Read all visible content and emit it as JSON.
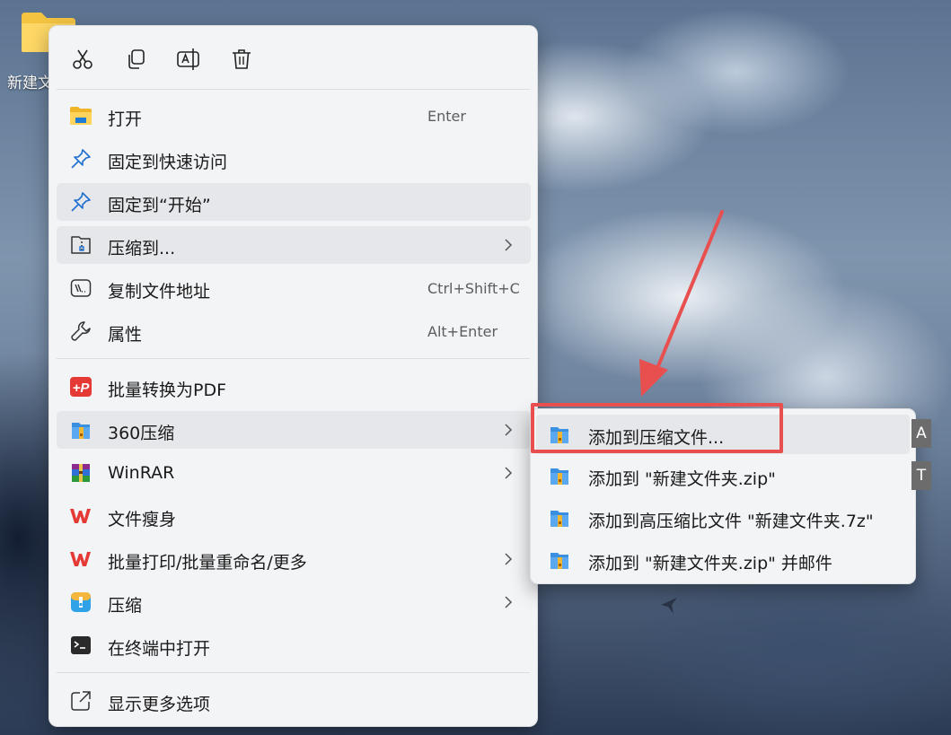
{
  "desktop": {
    "folder_label": "新建文",
    "folder_icon": "folder-icon"
  },
  "toolbar": {
    "buttons": [
      {
        "name": "cut-icon"
      },
      {
        "name": "copy-icon"
      },
      {
        "name": "rename-icon"
      },
      {
        "name": "delete-icon"
      }
    ]
  },
  "menu": {
    "items": [
      {
        "label": "打开",
        "shortcut": "Enter",
        "icon": "folder-icon"
      },
      {
        "label": "固定到快速访问",
        "shortcut": "",
        "icon": "pin-icon"
      },
      {
        "label": "固定到“开始”",
        "shortcut": "",
        "icon": "pin-icon"
      },
      {
        "label": "压缩到...",
        "shortcut": "",
        "icon": "zip-folder-icon"
      },
      {
        "label": "复制文件地址",
        "shortcut": "Ctrl+Shift+C",
        "icon": "path-icon"
      },
      {
        "label": "属性",
        "shortcut": "Alt+Enter",
        "icon": "wrench-icon"
      },
      {
        "label": "批量转换为PDF",
        "shortcut": "",
        "icon": "pdf-icon"
      },
      {
        "label": "360压缩",
        "shortcut": "",
        "icon": "zip360-icon"
      },
      {
        "label": "WinRAR",
        "shortcut": "",
        "icon": "winrar-icon"
      },
      {
        "label": "文件瘦身",
        "shortcut": "",
        "icon": "wps-icon"
      },
      {
        "label": "批量打印/批量重命名/更多",
        "shortcut": "",
        "icon": "wps-icon"
      },
      {
        "label": "压缩",
        "shortcut": "",
        "icon": "compress-icon"
      },
      {
        "label": "在终端中打开",
        "shortcut": "",
        "icon": "terminal-icon"
      },
      {
        "label": "显示更多选项",
        "shortcut": "",
        "icon": "share-icon"
      }
    ]
  },
  "submenu": {
    "items": [
      {
        "label": "添加到压缩文件...",
        "key": "A"
      },
      {
        "label": "添加到 \"新建文件夹.zip\"",
        "key": "T"
      },
      {
        "label": "添加到高压缩比文件 \"新建文件夹.7z\"",
        "key": ""
      },
      {
        "label": "添加到 \"新建文件夹.zip\" 并邮件",
        "key": ""
      }
    ]
  },
  "colors": {
    "highlight_box": "#e8504f",
    "menu_bg": "#f3f4f6",
    "hover_bg": "#e6e7ea"
  }
}
